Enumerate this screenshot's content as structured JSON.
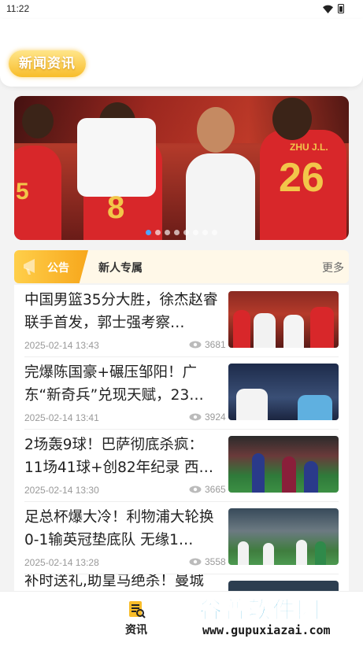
{
  "status_bar": {
    "time": "11:22"
  },
  "header": {
    "title": "新闻资讯"
  },
  "banner": {
    "jersey_numbers": [
      "5",
      "8",
      "26"
    ],
    "jersey_name": "ZHU J.L.",
    "dot_count": 8,
    "active_dot": 0
  },
  "notice": {
    "tag": "公告",
    "text": "新人专属",
    "more": "更多"
  },
  "news": [
    {
      "title": "中国男篮35分大胜，徐杰赵睿联手首发，郭士强考察…",
      "date": "2025-02-14 13:43",
      "views": "3681",
      "thumb": "basketball-team"
    },
    {
      "title": "完爆陈国豪+碾压邹阳！广东“新奇兵”兑现天赋，23…",
      "date": "2025-02-14 13:41",
      "views": "3924",
      "thumb": "basketball-players"
    },
    {
      "title": "2场轰9球！巴萨彻底杀疯：11场41球+创82年纪录 西…",
      "date": "2025-02-14 13:30",
      "views": "3665",
      "thumb": "soccer-barca"
    },
    {
      "title": "足总杯爆大冷！利物浦大轮换0-1输英冠垫底队 无缘1…",
      "date": "2025-02-14 13:28",
      "views": "3558",
      "thumb": "soccer-match"
    },
    {
      "title": "补时送礼,助皇马绝杀！曼城",
      "date": "",
      "views": "",
      "thumb": "soccer"
    }
  ],
  "tabbar": {
    "tabs": [
      {
        "label": "资讯",
        "icon": "news-icon"
      }
    ]
  },
  "watermark": {
    "main": "谷普软件园",
    "url": "www.gupuxiazai.com"
  },
  "colors": {
    "accent": "#f8bd2a",
    "dot_active": "#4fa4ff",
    "watermark": "#23a8d8"
  }
}
